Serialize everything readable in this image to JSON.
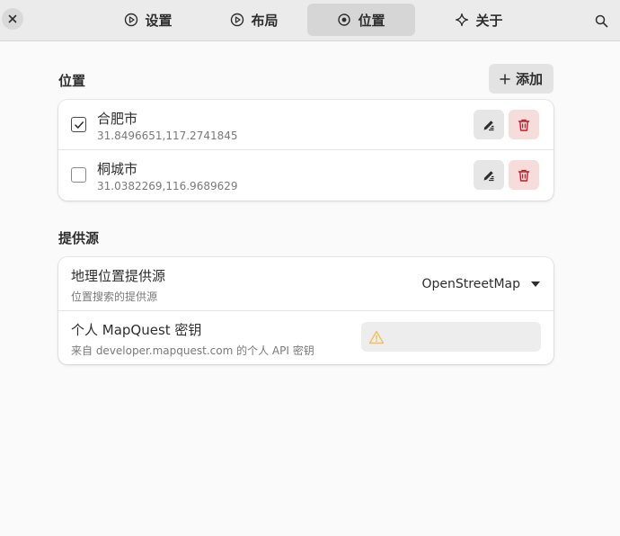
{
  "header": {
    "tabs": [
      {
        "label": "设置",
        "icon": "settings-icon"
      },
      {
        "label": "布局",
        "icon": "layout-icon"
      },
      {
        "label": "位置",
        "icon": "location-target-icon",
        "active": true
      },
      {
        "label": "关于",
        "icon": "sparkle-icon"
      }
    ]
  },
  "locations": {
    "title": "位置",
    "add_label": "添加",
    "items": [
      {
        "name": "合肥市",
        "coords": "31.8496651,117.2741845",
        "checked": true
      },
      {
        "name": "桐城市",
        "coords": "31.0382269,116.9689629",
        "checked": false
      }
    ]
  },
  "providers": {
    "title": "提供源",
    "geo": {
      "title": "地理位置提供源",
      "subtitle": "位置搜索的提供源",
      "selected": "OpenStreetMap"
    },
    "mapquest": {
      "title": "个人 MapQuest 密钥",
      "subtitle": "来自 developer.mapquest.com 的个人 API 密钥",
      "value": ""
    }
  },
  "colors": {
    "accent_delete": "#c01c28",
    "warning": "#f0c060"
  }
}
